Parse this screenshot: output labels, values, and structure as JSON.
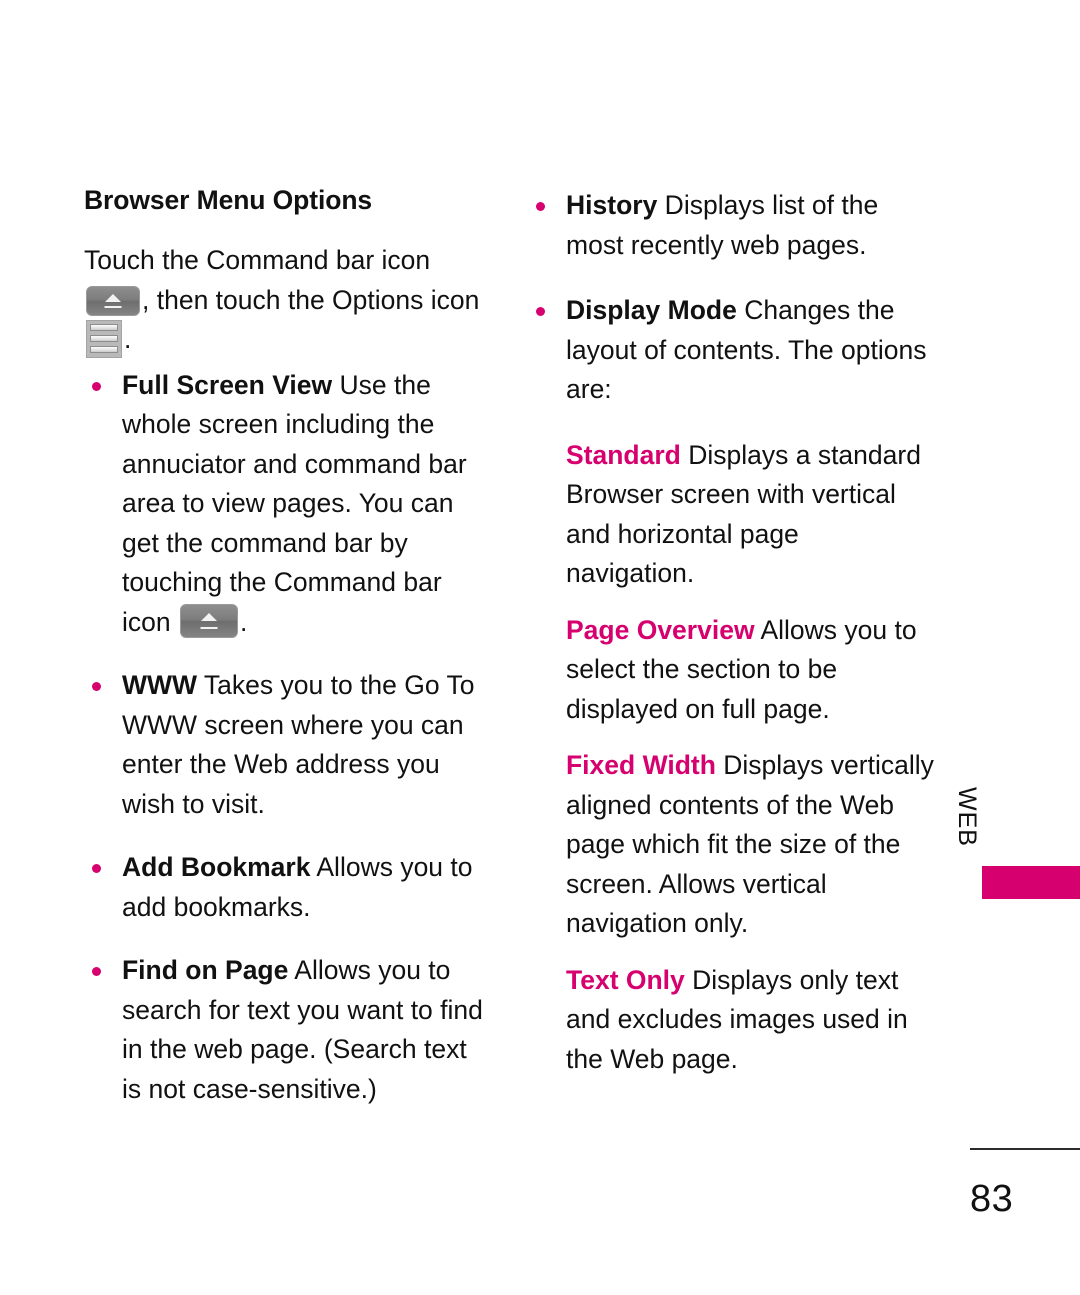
{
  "page": {
    "number": "83",
    "edge_tab": "WEB",
    "accent_color": "#d6006e",
    "text_color": "#111111",
    "background_color": "#ffffff"
  },
  "left_column": {
    "heading": "Browser Menu Options",
    "intro": {
      "part1": "Touch the Command bar icon",
      "icon1": "command-bar-icon",
      "part2": ", then touch the Options",
      "part3": "icon",
      "icon2": "options-menu-icon",
      "part4": "."
    },
    "bullets": [
      {
        "term": "Full Screen View",
        "rest": " Use the whole screen including the annuciator and command bar area to view pages. You can get the command bar by touching the Command bar icon",
        "trailing_icon": "command-bar-icon",
        "rest_after_icon": "."
      },
      {
        "term": "WWW",
        "rest": " Takes you to the Go To WWW screen where you can enter the Web address you wish to visit."
      },
      {
        "term": "Add Bookmark",
        "rest": " Allows you to add bookmarks."
      },
      {
        "term": "Find on Page",
        "rest": "  Allows you to search for text you want to find in the web page. (Search text is not case-sensitive.)"
      }
    ]
  },
  "right_column": {
    "bullets": [
      {
        "term": "History",
        "rest": " Displays list of the most recently web pages."
      },
      {
        "term": "Display Mode",
        "rest": " Changes the layout of contents. The options are:"
      }
    ],
    "display_mode_options": [
      {
        "term": "Standard",
        "rest": " Displays a standard Browser screen with vertical and horizontal page navigation."
      },
      {
        "term": "Page Overview",
        "rest": "  Allows you to select the section to be displayed on full page."
      },
      {
        "term": "Fixed Width",
        "rest": " Displays vertically aligned contents of the Web page which fit the size of the screen. Allows vertical navigation only."
      },
      {
        "term": "Text Only",
        "rest": " Displays only text and excludes images used in the Web page."
      }
    ]
  }
}
